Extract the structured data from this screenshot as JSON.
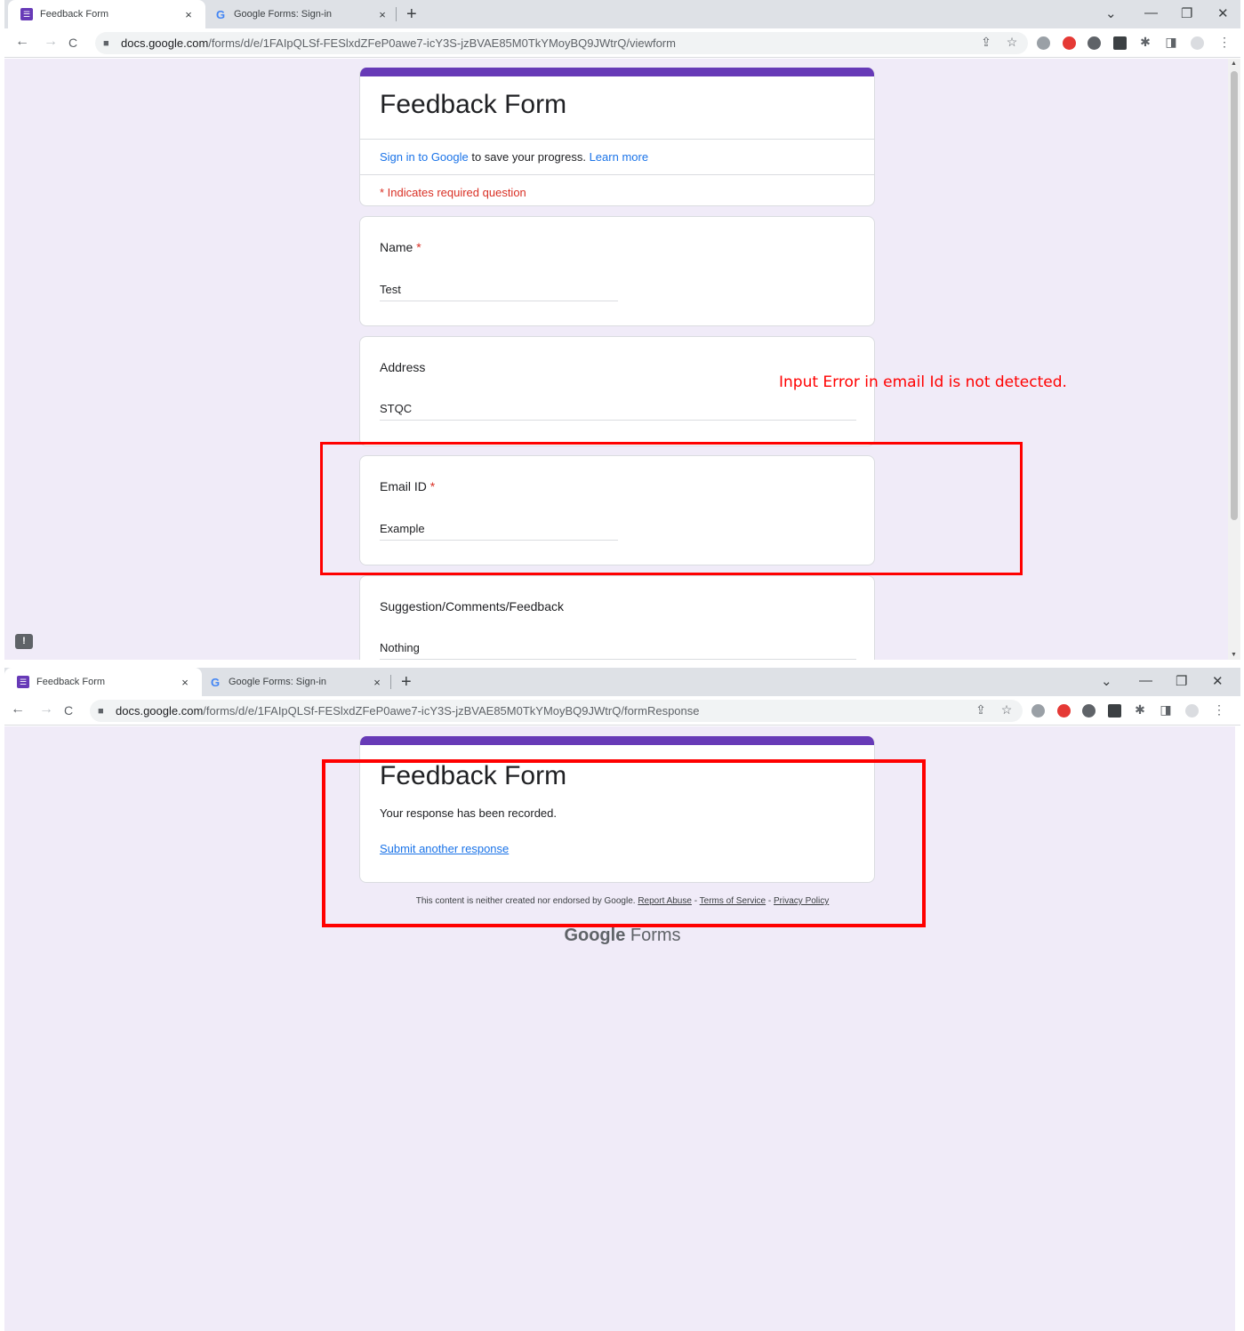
{
  "screen1": {
    "tabs": [
      {
        "title": "Feedback Form",
        "close": "×"
      },
      {
        "title": "Google Forms: Sign-in",
        "close": "×"
      }
    ],
    "new_tab": "+",
    "window": {
      "dropdown": "⌄",
      "minimize": "—",
      "restore": "❐",
      "close": "✕"
    },
    "url_domain": "docs.google.com",
    "url_path": "/forms/d/e/1FAIpQLSf-FESlxdZFeP0awe7-icY3S-jzBVAE85M0TkYMoyBQ9JWtrQ/viewform",
    "form": {
      "title": "Feedback Form",
      "signin_link": "Sign in to Google",
      "signin_text": " to save your progress. ",
      "learn_more": "Learn more",
      "required_note": "* Indicates required question",
      "questions": [
        {
          "label": "Name",
          "required": "*",
          "answer": "Test"
        },
        {
          "label": "Address",
          "required": "",
          "answer": "STQC"
        },
        {
          "label": "Email ID",
          "required": "*",
          "answer": "Example"
        },
        {
          "label": "Suggestion/Comments/Feedback",
          "required": "",
          "answer": "Nothing"
        }
      ]
    },
    "annotation": "Input Error in email Id is not detected.",
    "feedback_icon": "!"
  },
  "screen2": {
    "tabs": [
      {
        "title": "Feedback Form",
        "close": "×"
      },
      {
        "title": "Google Forms: Sign-in",
        "close": "×"
      }
    ],
    "new_tab": "+",
    "window": {
      "dropdown": "⌄",
      "minimize": "—",
      "restore": "❐",
      "close": "✕"
    },
    "url_domain": "docs.google.com",
    "url_path": "/forms/d/e/1FAIpQLSf-FESlxdZFeP0awe7-icY3S-jzBVAE85M0TkYMoyBQ9JWtrQ/formResponse",
    "form": {
      "title": "Feedback Form",
      "message": "Your response has been recorded.",
      "submit_another": "Submit another response"
    },
    "footer": {
      "text": "This content is neither created nor endorsed by Google. ",
      "report_abuse": "Report Abuse",
      "sep": " - ",
      "terms": "Terms of Service",
      "privacy": "Privacy Policy"
    },
    "brand_google": "Google",
    "brand_forms": " Forms"
  },
  "browser": {
    "back": "←",
    "forward": "→",
    "reload": "C",
    "lock": "🔒",
    "share": "⇪",
    "star": "☆",
    "puzzle": "✱",
    "sidepanel": "◨",
    "profile": "●",
    "menu": "⋮"
  },
  "colors": {
    "accent": "#673ab7",
    "background": "#f0ebf8",
    "required": "#d93025",
    "link": "#1a73e8",
    "annotation": "#ff0000"
  }
}
